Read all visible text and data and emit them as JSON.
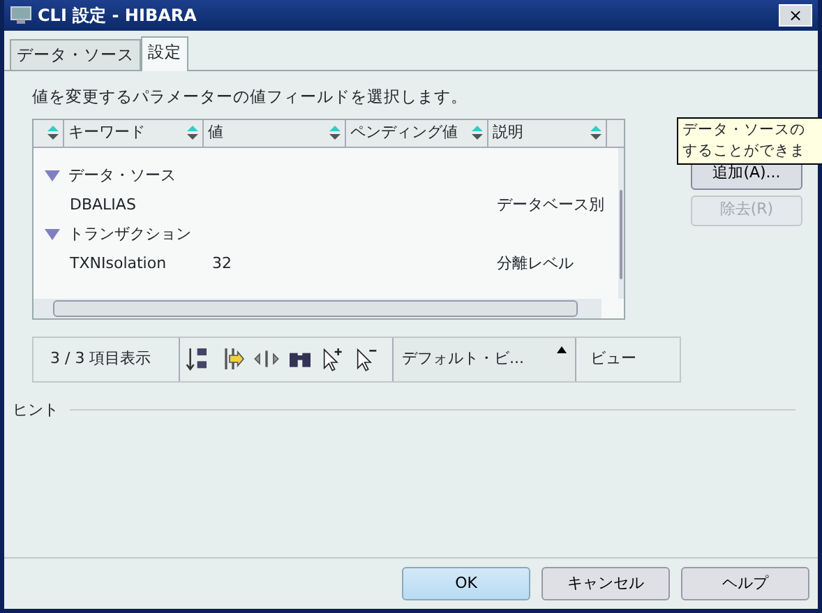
{
  "window": {
    "title": "CLI 設定 - HIBARA",
    "close": "×"
  },
  "tabs": [
    {
      "label": "データ・ソース",
      "selected": false
    },
    {
      "label": "設定",
      "selected": true
    }
  ],
  "instruction": "値を変更するパラメーターの値フィールドを選択します。",
  "table": {
    "columns": [
      "キーワード",
      "値",
      "ペンディング値",
      "説明"
    ],
    "rows": [
      {
        "kind": "group",
        "label": "データ・ソース",
        "expanded": true,
        "children": [
          {
            "kind": "item",
            "keyword": "DBALIAS",
            "description": "データベース別"
          }
        ]
      },
      {
        "kind": "group",
        "label": "トランザクション",
        "expanded": true,
        "children": [
          {
            "kind": "item",
            "keyword": "TXNIsolation",
            "value": "32",
            "description": "分離レベル"
          }
        ]
      }
    ]
  },
  "side_buttons": [
    {
      "label": "追加(A)...",
      "disabled": false
    },
    {
      "label": "除去(R)",
      "disabled": true
    }
  ],
  "tooltip": [
    "データ・ソースの",
    "することができま"
  ],
  "toolbar": {
    "count": "3 / 3 項目表示",
    "view_select": "デフォルト・ビ...",
    "view_button": "ビュー"
  },
  "hint": {
    "label": "ヒント"
  },
  "buttons": [
    {
      "label": "OK",
      "default": true
    },
    {
      "label": "キャンセル",
      "default": false
    },
    {
      "label": "ヘルプ",
      "default": false
    }
  ]
}
